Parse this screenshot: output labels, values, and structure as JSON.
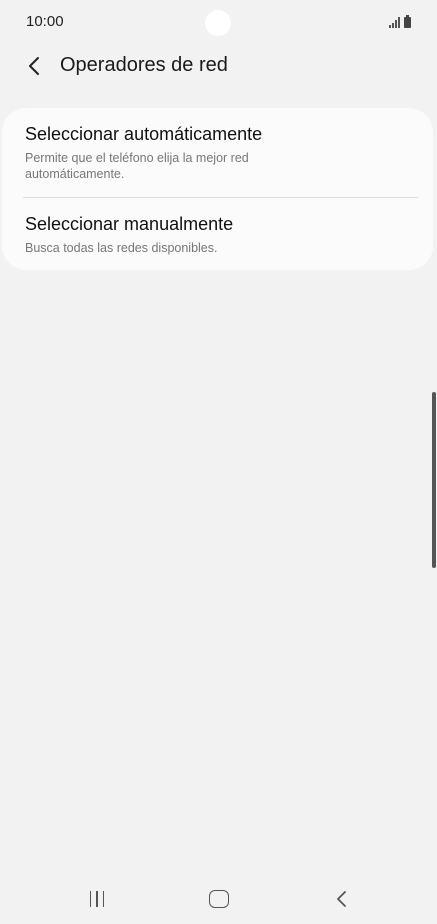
{
  "status_bar": {
    "time": "10:00",
    "icons": [
      "signal-icon",
      "battery-icon"
    ]
  },
  "header": {
    "back_icon": "chevron-left-icon",
    "title": "Operadores de red"
  },
  "options": [
    {
      "title": "Seleccionar automáticamente",
      "description": "Permite que el teléfono elija la mejor red automáticamente."
    },
    {
      "title": "Seleccionar manualmente",
      "description": "Busca todas las redes disponibles."
    }
  ],
  "nav_bar": {
    "icons": [
      "recents-icon",
      "home-icon",
      "back-icon"
    ]
  },
  "colors": {
    "background": "#f2f2f2",
    "card": "#fbfbfb",
    "primary_text": "#111111",
    "secondary_text": "#777777"
  }
}
